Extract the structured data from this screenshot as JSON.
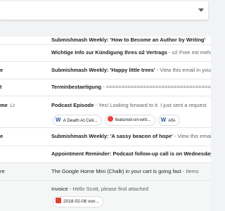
{
  "inbox_rows": [
    {
      "sender": "",
      "subject": "Submishmash Weekly: 'How to Become an Author by Writing'",
      "snippet": ""
    },
    {
      "sender": "",
      "subject": "Wichtige Info zur Kündigung Ihres o2 Vertrags",
      "snippet": " - o2 Free mit mehr"
    },
    {
      "sender": "e",
      "subject": "Submishmash Weekly: 'Happy little trees'",
      "snippet": " - View this email in your"
    },
    {
      "sender": "t",
      "subject": "Terminbestaetigung",
      "snippet": " - ======================================"
    },
    {
      "sender": "me",
      "count": "12",
      "subject": "Podcast Episode",
      "snippet": " - Yes! Looking forward to it. I just sent a request"
    },
    {
      "sender": "e",
      "subject": "Submishmash Weekly: 'A sassy beacon of hope'",
      "snippet": " - View this email in your"
    },
    {
      "sender": "",
      "subject": "Appointment Reminder: Podcast follow-up call is on Wednesday",
      "snippet": ""
    },
    {
      "sender": "re",
      "subject": "The Google Home Mini (Chalk) in your cart is going fast",
      "snippet": " - Items"
    },
    {
      "sender": "",
      "subject": "Invoice",
      "snippet": " - Hello Scott, please find attached"
    }
  ],
  "podcast_attachments": [
    {
      "icon": "word-doc-icon",
      "name": "A Death At Celi..."
    },
    {
      "icon": "file-icon",
      "name": "featured-on-writ..."
    },
    {
      "icon": "word-doc-icon",
      "name": "AN-"
    }
  ],
  "invoice_attachments": [
    {
      "icon": "pdf-icon",
      "name": "2018-02-06 von..."
    }
  ],
  "colors": {
    "accent_pdf": "#db4437",
    "word_blue": "#2b5797",
    "background": "#f1f3f4"
  }
}
